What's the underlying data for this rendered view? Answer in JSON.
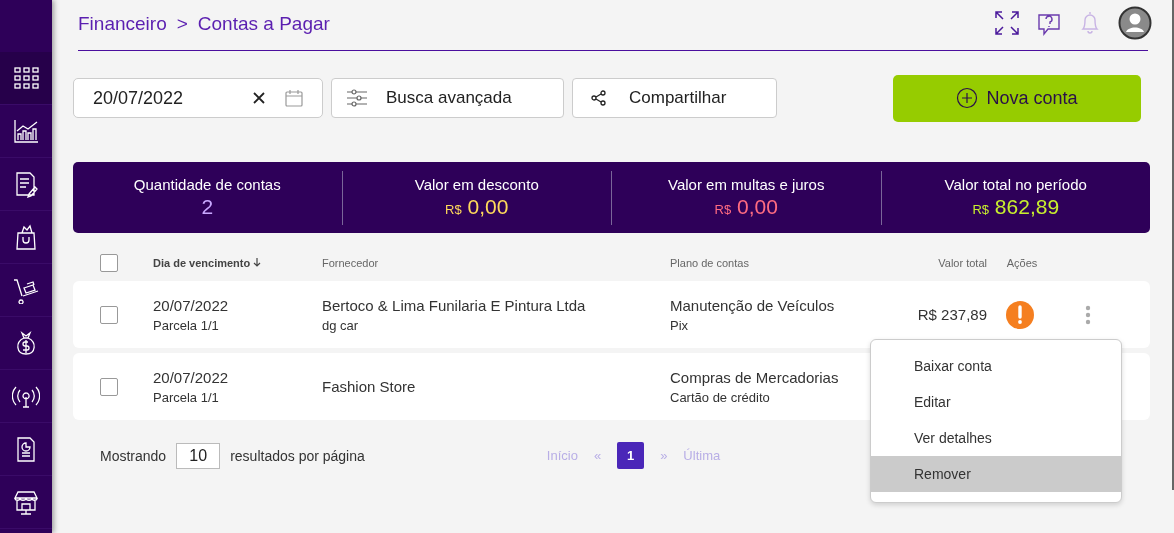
{
  "breadcrumb": {
    "parent": "Financeiro",
    "separator": ">",
    "current": "Contas a Pagar"
  },
  "sidebar": {
    "items": [
      {
        "selected": true
      },
      {
        "selected": false
      },
      {
        "selected": false
      },
      {
        "selected": false
      },
      {
        "selected": false
      },
      {
        "selected": false
      },
      {
        "selected": false
      },
      {
        "selected": false
      },
      {
        "selected": false
      }
    ]
  },
  "toolbar": {
    "date_field": {
      "value": "20/07/2022"
    },
    "advanced_search": "Busca avançada",
    "share": "Compartilhar",
    "new_button": "Nova conta"
  },
  "summary": [
    {
      "label": "Quantidade de contas",
      "value": "2",
      "kind": "count"
    },
    {
      "label": "Valor em desconto",
      "currency": "R$",
      "value": "0,00",
      "kind": "discount"
    },
    {
      "label": "Valor em multas e juros",
      "currency": "R$",
      "value": "0,00",
      "kind": "fine"
    },
    {
      "label": "Valor total no período",
      "currency": "R$",
      "value": "862,89",
      "kind": "total"
    }
  ],
  "table": {
    "select_all": {
      "checked": false
    },
    "columns": [
      "Dia de vencimento",
      "Fornecedor",
      "Plano de contas",
      "Valor total",
      "Ações"
    ],
    "rows": [
      {
        "checked": false,
        "date": "20/07/2022",
        "installment": "Parcela 1/1",
        "supplier": "Bertoco & Lima Funilaria E Pintura Ltda",
        "supplier_note": "dg car",
        "plan": "Manutenção de Veículos",
        "payment": "Pix",
        "value": "R$ 237,89",
        "alert": true
      },
      {
        "checked": false,
        "date": "20/07/2022",
        "installment": "Parcela 1/1",
        "supplier": "Fashion Store",
        "plan": "Compras de Mercadorias",
        "payment": "Cartão de crédito"
      }
    ]
  },
  "action_menu": {
    "items": [
      {
        "label": "Baixar conta",
        "selected": false
      },
      {
        "label": "Editar",
        "selected": false
      },
      {
        "label": "Ver detalhes",
        "selected": false
      },
      {
        "label": "Remover",
        "selected": true
      }
    ]
  },
  "pagination": {
    "showing": "Mostrando",
    "per_page": "10",
    "per_page_suffix": "resultados por página",
    "first": "Início",
    "prev": "«",
    "pages": [
      {
        "label": "1",
        "selected": true
      }
    ],
    "next": "»",
    "last": "Última"
  }
}
